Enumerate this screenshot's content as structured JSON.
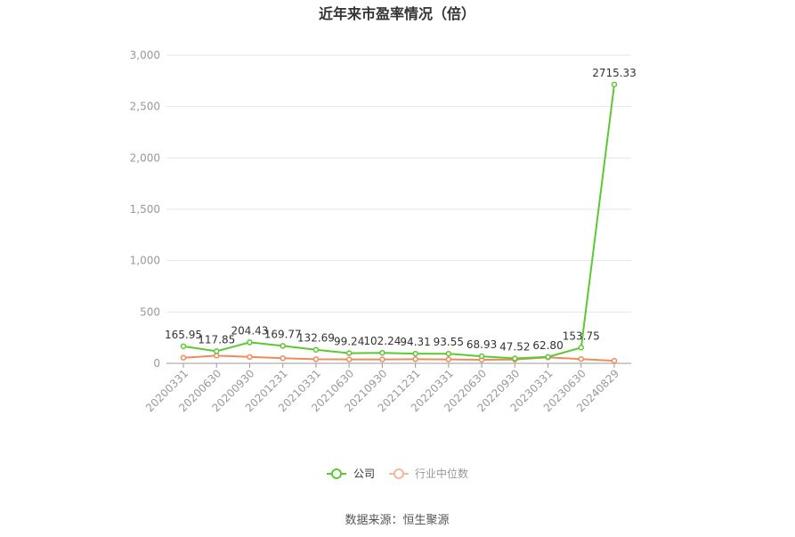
{
  "chart_data": {
    "type": "line",
    "title": "近年来市盈率情况（倍）",
    "categories": [
      "20200331",
      "20200630",
      "20200930",
      "20201231",
      "20210331",
      "20210630",
      "20210930",
      "20211231",
      "20220331",
      "20220630",
      "20220930",
      "20230331",
      "20230630",
      "20240829"
    ],
    "series": [
      {
        "name": "公司",
        "color": "#5cc832",
        "values": [
          165.95,
          117.85,
          204.43,
          169.77,
          132.69,
          99.24,
          102.24,
          94.31,
          93.55,
          68.93,
          47.52,
          62.8,
          153.75,
          2715.33
        ],
        "labels": [
          "165.95",
          "117.85",
          "204.43",
          "169.77",
          "132.69",
          "99.24",
          "102.24",
          "94.31",
          "93.55",
          "68.93",
          "47.52",
          "62.80",
          "153.75",
          "2715.33"
        ]
      },
      {
        "name": "行业中位数",
        "color": "#f08a5d",
        "values": [
          55,
          75,
          62,
          50,
          40,
          38,
          38,
          40,
          38,
          35,
          37,
          58,
          42,
          25
        ]
      }
    ],
    "yticks": [
      "0",
      "500",
      "1,000",
      "1,500",
      "2,000",
      "2,500",
      "3,000"
    ],
    "ylim": [
      0,
      3000
    ],
    "grid": true,
    "legend": "bottom-center",
    "source": "数据来源：恒生聚源"
  }
}
